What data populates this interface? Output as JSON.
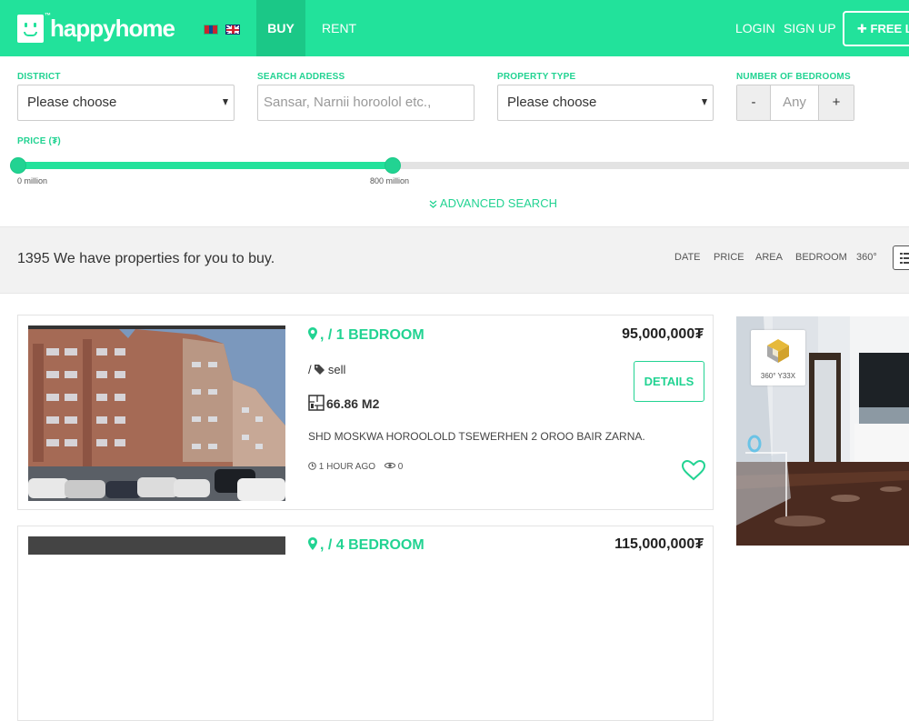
{
  "header": {
    "brand": "happyhome",
    "trademark": "™",
    "nav": {
      "buy": "BUY",
      "rent": "RENT"
    },
    "auth": {
      "login": "LOGIN",
      "signup": "SIGN UP"
    },
    "free_listing": "✚ FREE LIS"
  },
  "search": {
    "district": {
      "label": "DISTRICT",
      "value": "Please choose"
    },
    "address": {
      "label": "SEARCH ADDRESS",
      "placeholder": "Sansar, Narnii horoolol etc.,"
    },
    "property_type": {
      "label": "PROPERTY TYPE",
      "value": "Please choose"
    },
    "bedrooms": {
      "label": "NUMBER OF BEDROOMS",
      "minus": "-",
      "value": "Any",
      "plus": "+"
    },
    "price": {
      "label": "PRICE (₮)",
      "min_label": "0 million",
      "max_label": "800 million"
    },
    "advanced": "ADVANCED SEARCH"
  },
  "results": {
    "count_text": "1395 We have properties for you to buy.",
    "sort": [
      "DATE",
      "PRICE",
      "AREA",
      "BEDROOM",
      "360°"
    ]
  },
  "listings": [
    {
      "title": ", / 1 BEDROOM",
      "price": "95,000,000₮",
      "type": "/ ",
      "type_tag": "sell",
      "area": "66.86 M2",
      "details": "DETAILS",
      "description": "SHD MOSKWA HOROOLOLD TSEWERHEN 2 OROO BAIR ZARNA.",
      "time": "1 HOUR AGO",
      "views": "0"
    },
    {
      "title": ", / 4 BEDROOM",
      "price": "115,000,000₮"
    }
  ],
  "featured": {
    "badge": "360° Y33X"
  },
  "colors": {
    "accent": "#22e29b",
    "accent_dark": "#1bc887",
    "text_accent": "#22d392"
  }
}
